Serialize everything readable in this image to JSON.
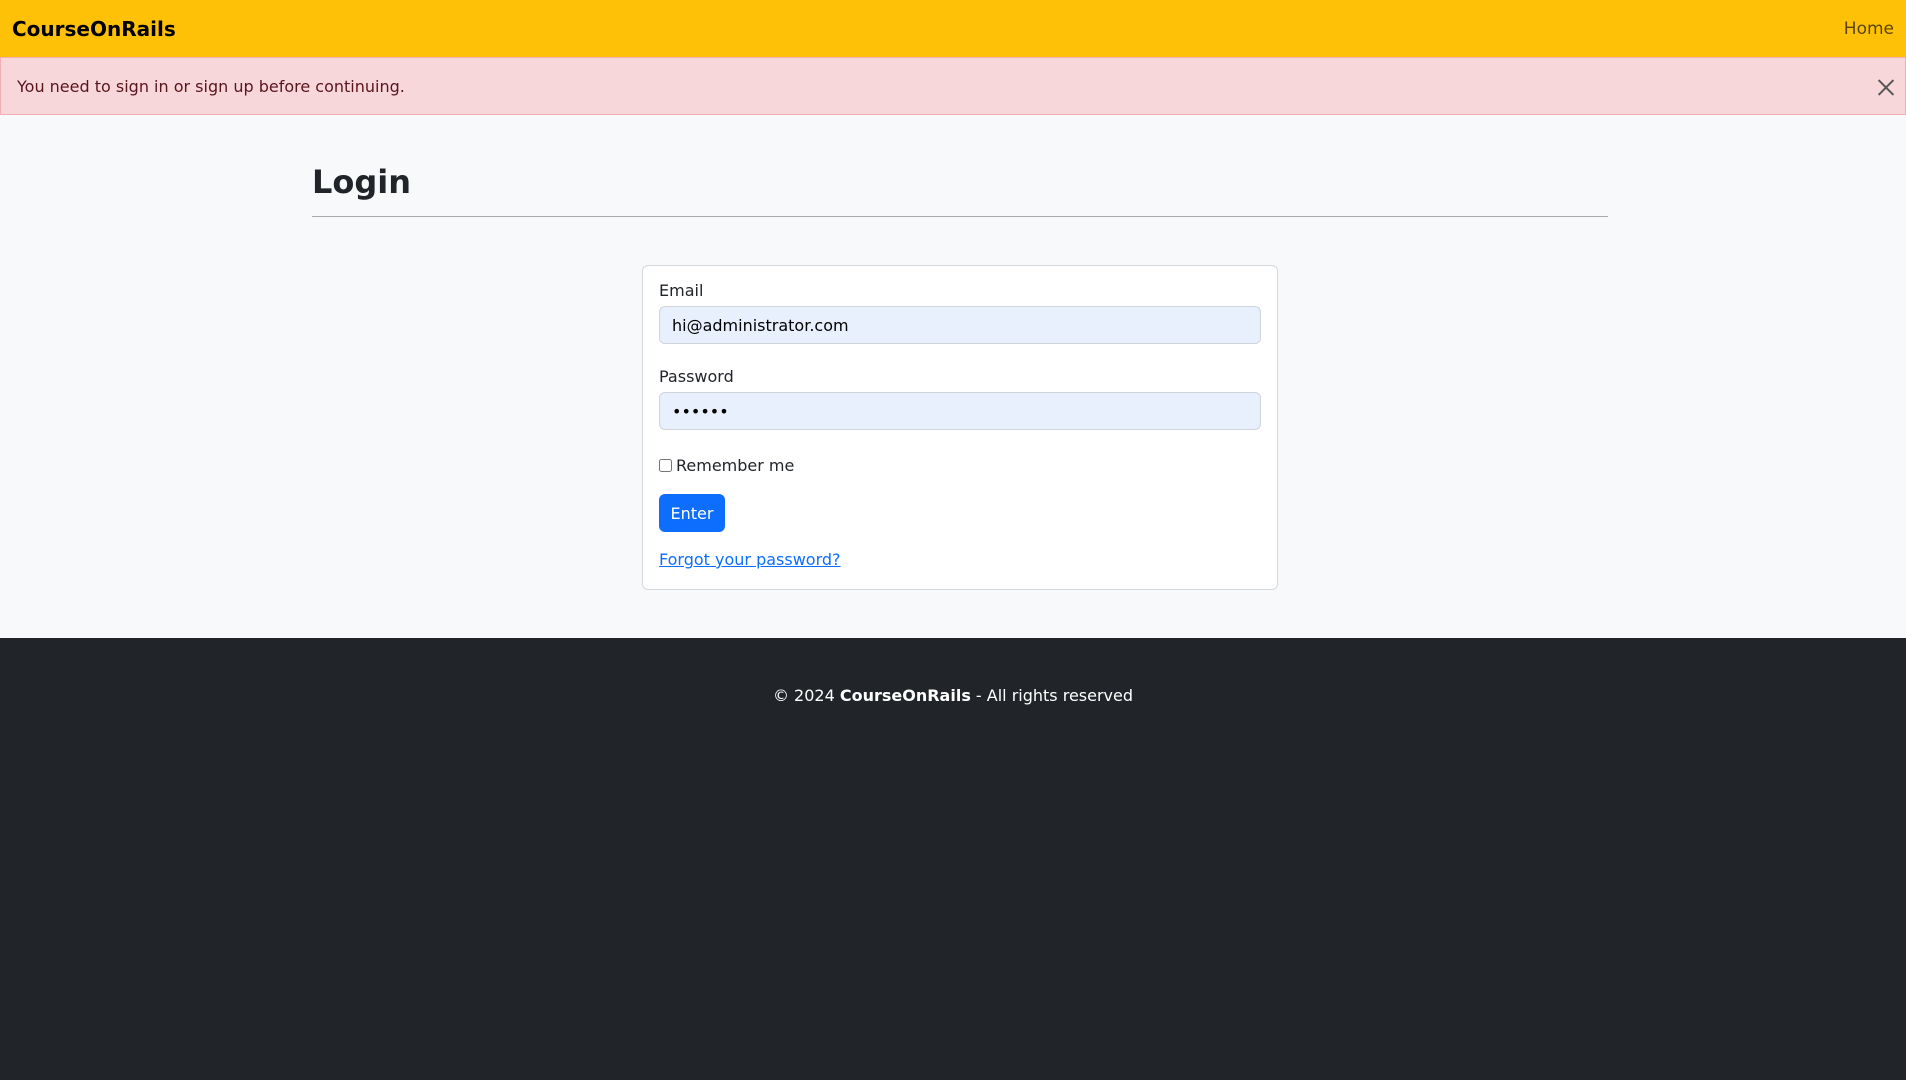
{
  "navbar": {
    "brand": "CourseOnRails",
    "home_link": "Home"
  },
  "alert": {
    "message": "You need to sign in or sign up before continuing.",
    "close_icon": "close-icon"
  },
  "page": {
    "title": "Login"
  },
  "form": {
    "email_label": "Email",
    "email_value": "hi@administrator.com",
    "password_label": "Password",
    "password_value": "••••••",
    "remember_label": "Remember me",
    "remember_checked": false,
    "submit_label": "Enter",
    "forgot_link": "Forgot your password?"
  },
  "footer": {
    "prefix": "© 2024 ",
    "brand": "CourseOnRails",
    "suffix": " - All rights reserved"
  },
  "colors": {
    "navbar_bg": "#ffc107",
    "alert_bg": "#f8d7da",
    "primary": "#0d6efd",
    "footer_bg": "#212529",
    "main_bg": "#f8f9fa"
  }
}
